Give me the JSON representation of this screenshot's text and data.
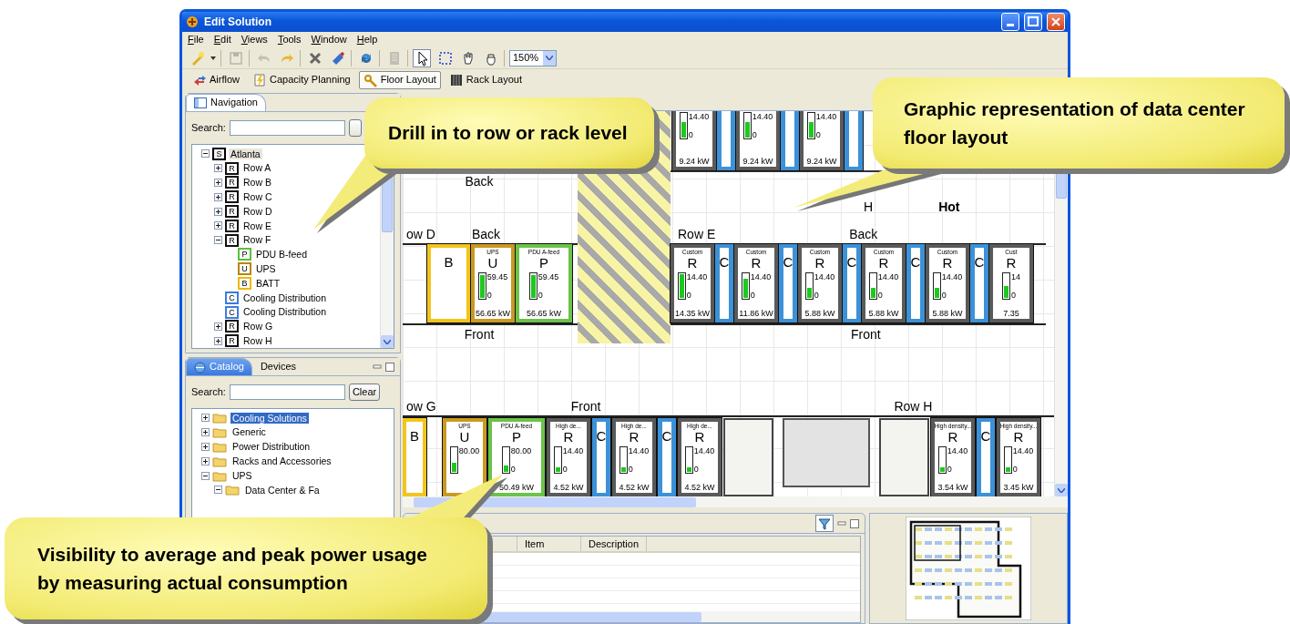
{
  "window": {
    "title": "Edit Solution"
  },
  "menu": [
    "File",
    "Edit",
    "Views",
    "Tools",
    "Window",
    "Help"
  ],
  "toolbar": {
    "actions": [
      {
        "kind": "new",
        "disabled": false
      },
      {
        "kind": "save",
        "disabled": true
      },
      {
        "kind": "undo",
        "disabled": true
      },
      {
        "kind": "redo",
        "disabled": false
      },
      {
        "kind": "delete",
        "disabled": false
      },
      {
        "kind": "paint",
        "disabled": false
      },
      {
        "kind": "refresh",
        "disabled": false
      },
      {
        "kind": "rack",
        "disabled": true
      }
    ],
    "tools": [
      {
        "kind": "pointer",
        "selected": true
      },
      {
        "kind": "marquee",
        "selected": false
      },
      {
        "kind": "pan",
        "selected": false
      },
      {
        "kind": "grab",
        "selected": false
      }
    ],
    "zoom": "150%"
  },
  "perspectives": [
    {
      "kind": "airflow",
      "label": "Airflow",
      "selected": false
    },
    {
      "kind": "capacity",
      "label": "Capacity Planning",
      "selected": false
    },
    {
      "kind": "floor",
      "label": "Floor Layout",
      "selected": true
    },
    {
      "kind": "rack",
      "label": "Rack Layout",
      "selected": false
    }
  ],
  "navigation": {
    "tab": "Navigation",
    "search_label": "Search:",
    "tree": [
      {
        "kind": "site",
        "badge": "S",
        "label": "Atlanta",
        "expanded": true,
        "selected": true,
        "children": [
          {
            "kind": "rack",
            "badge": "R",
            "label": "Row A",
            "expanded": false,
            "selected": false
          },
          {
            "kind": "rack",
            "badge": "R",
            "label": "Row B",
            "expanded": false,
            "selected": false
          },
          {
            "kind": "rack",
            "badge": "R",
            "label": "Row C",
            "expanded": false,
            "selected": false
          },
          {
            "kind": "rack",
            "badge": "R",
            "label": "Row D",
            "expanded": false,
            "selected": false
          },
          {
            "kind": "rack",
            "badge": "R",
            "label": "Row E",
            "expanded": false,
            "selected": false
          },
          {
            "kind": "rack",
            "badge": "R",
            "label": "Row F",
            "expanded": true,
            "selected": false,
            "children": [
              {
                "kind": "pdu",
                "badge": "P",
                "label": "PDU B-feed",
                "selected": false
              },
              {
                "kind": "ups",
                "badge": "U",
                "label": "UPS",
                "selected": false
              },
              {
                "kind": "battery",
                "badge": "B",
                "label": "BATT",
                "selected": false
              }
            ]
          },
          {
            "kind": "cooling",
            "badge": "C",
            "label": "Cooling Distribution",
            "selected": false
          },
          {
            "kind": "cooling",
            "badge": "C",
            "label": "Cooling Distribution",
            "selected": false
          },
          {
            "kind": "rack",
            "badge": "R",
            "label": "Row G",
            "expanded": false,
            "selected": false
          },
          {
            "kind": "rack",
            "badge": "R",
            "label": "Row H",
            "expanded": false,
            "selected": false
          }
        ]
      }
    ]
  },
  "catalog": {
    "tabs": [
      {
        "label": "Catalog",
        "selected": true
      },
      {
        "label": "Devices",
        "selected": false
      }
    ],
    "search_label": "Search:",
    "clear_button": "Clear",
    "tree": [
      {
        "label": "Cooling Solutions",
        "expanded": false,
        "selected": true
      },
      {
        "label": "Generic",
        "expanded": false,
        "selected": false
      },
      {
        "label": "Power Distribution",
        "expanded": false,
        "selected": false
      },
      {
        "label": "Racks and Accessories",
        "expanded": false,
        "selected": false
      },
      {
        "label": "UPS",
        "expanded": true,
        "selected": false,
        "children": [
          {
            "label": "Data Center & Fa",
            "expanded": true,
            "selected": false
          }
        ]
      }
    ]
  },
  "floor_layout": {
    "upper_left": {
      "top_label": "Back",
      "row_label": "ow D",
      "side_label": "Back",
      "bottom_label": "Front",
      "units": [
        {
          "kind": "battery",
          "letter": "B"
        },
        {
          "kind": "ups",
          "caption": "UPS",
          "letter": "U",
          "max": "59.45",
          "min": "0",
          "reading": "56.65 kW",
          "level": 0.95
        },
        {
          "kind": "pdu",
          "caption": "PDU A-feed",
          "letter": "P",
          "max": "59.45",
          "min": "0",
          "reading": "56.65 kW",
          "level": 0.95
        }
      ]
    },
    "upper_right": {
      "aisle_letter": "H",
      "aisle_label": "Hot",
      "row_label": "Row E",
      "side_label": "Back",
      "bottom_label": "Front",
      "top_units": [
        {
          "kind": "rack",
          "max": "14.40",
          "min": "0",
          "reading": "9.24 kW",
          "level": 0.64
        },
        {
          "kind": "cooling"
        },
        {
          "kind": "rack",
          "max": "14.40",
          "min": "0",
          "reading": "9.24 kW",
          "level": 0.64
        },
        {
          "kind": "cooling"
        },
        {
          "kind": "rack",
          "max": "14.40",
          "min": "0",
          "reading": "9.24 kW",
          "level": 0.64
        },
        {
          "kind": "cooling"
        }
      ],
      "units": [
        {
          "kind": "rack",
          "caption": "Custom",
          "letter": "R",
          "max": "14.40",
          "min": "0",
          "reading": "14.35 kW",
          "level": 1.0
        },
        {
          "kind": "cooling",
          "letter": "C"
        },
        {
          "kind": "rack",
          "caption": "Custom",
          "letter": "R",
          "max": "14.40",
          "min": "0",
          "reading": "11.86 kW",
          "level": 0.82
        },
        {
          "kind": "cooling",
          "letter": "C"
        },
        {
          "kind": "rack",
          "caption": "Custom",
          "letter": "R",
          "max": "14.40",
          "min": "0",
          "reading": "5.88 kW",
          "level": 0.41
        },
        {
          "kind": "cooling",
          "letter": "C"
        },
        {
          "kind": "rack",
          "caption": "Custom",
          "letter": "R",
          "max": "14.40",
          "min": "0",
          "reading": "5.88 kW",
          "level": 0.41
        },
        {
          "kind": "cooling",
          "letter": "C"
        },
        {
          "kind": "rack",
          "caption": "Custom",
          "letter": "R",
          "max": "14.40",
          "min": "0",
          "reading": "5.88 kW",
          "level": 0.41
        },
        {
          "kind": "cooling",
          "letter": "C"
        },
        {
          "kind": "rack",
          "caption": "Cust",
          "letter": "R",
          "max": "14",
          "min": "0",
          "reading": "7.35",
          "level": 0.5
        }
      ]
    },
    "lower": {
      "row_label": "ow G",
      "side_label": "Front",
      "second_row_label": "Row H",
      "units": [
        {
          "kind": "battery",
          "letter": "B"
        },
        {
          "kind": "ups",
          "caption": "UPS",
          "letter": "U",
          "max": "80.00",
          "level": 0.4
        },
        {
          "kind": "pdu",
          "caption": "PDU A-feed",
          "letter": "P",
          "max": "80.00",
          "min": "0",
          "reading": "50.49 kW",
          "level": 0.3
        },
        {
          "kind": "rack",
          "caption": "High de...",
          "letter": "R",
          "max": "14.40",
          "min": "0",
          "reading": "4.52 kW",
          "level": 0.2
        },
        {
          "kind": "cooling",
          "letter": "C"
        },
        {
          "kind": "rack",
          "caption": "High de...",
          "letter": "R",
          "max": "14.40",
          "min": "0",
          "reading": "4.52 kW",
          "level": 0.2
        },
        {
          "kind": "cooling",
          "letter": "C"
        },
        {
          "kind": "rack",
          "caption": "High de...",
          "letter": "R",
          "max": "14.40",
          "min": "0",
          "reading": "4.52 kW",
          "level": 0.2
        },
        {
          "kind": "blank"
        },
        {
          "kind": "cabinet"
        },
        {
          "kind": "blank"
        },
        {
          "kind": "rack",
          "caption": "High density...",
          "letter": "R",
          "max": "14.40",
          "min": "0",
          "reading": "3.54 kW",
          "level": 0.2
        },
        {
          "kind": "cooling",
          "letter": "C"
        },
        {
          "kind": "rack",
          "caption": "High density...",
          "letter": "R",
          "max": "14.40",
          "min": "0",
          "reading": "3.45 kW",
          "level": 0.2
        }
      ]
    }
  },
  "bottom_panel": {
    "columns": [
      "Item",
      "Description"
    ]
  },
  "callouts": [
    {
      "text": "Drill in to row or rack level"
    },
    {
      "text": "Graphic representation of data center floor layout"
    },
    {
      "text": "Visibility to average and peak power usage by measuring actual consumption"
    }
  ]
}
